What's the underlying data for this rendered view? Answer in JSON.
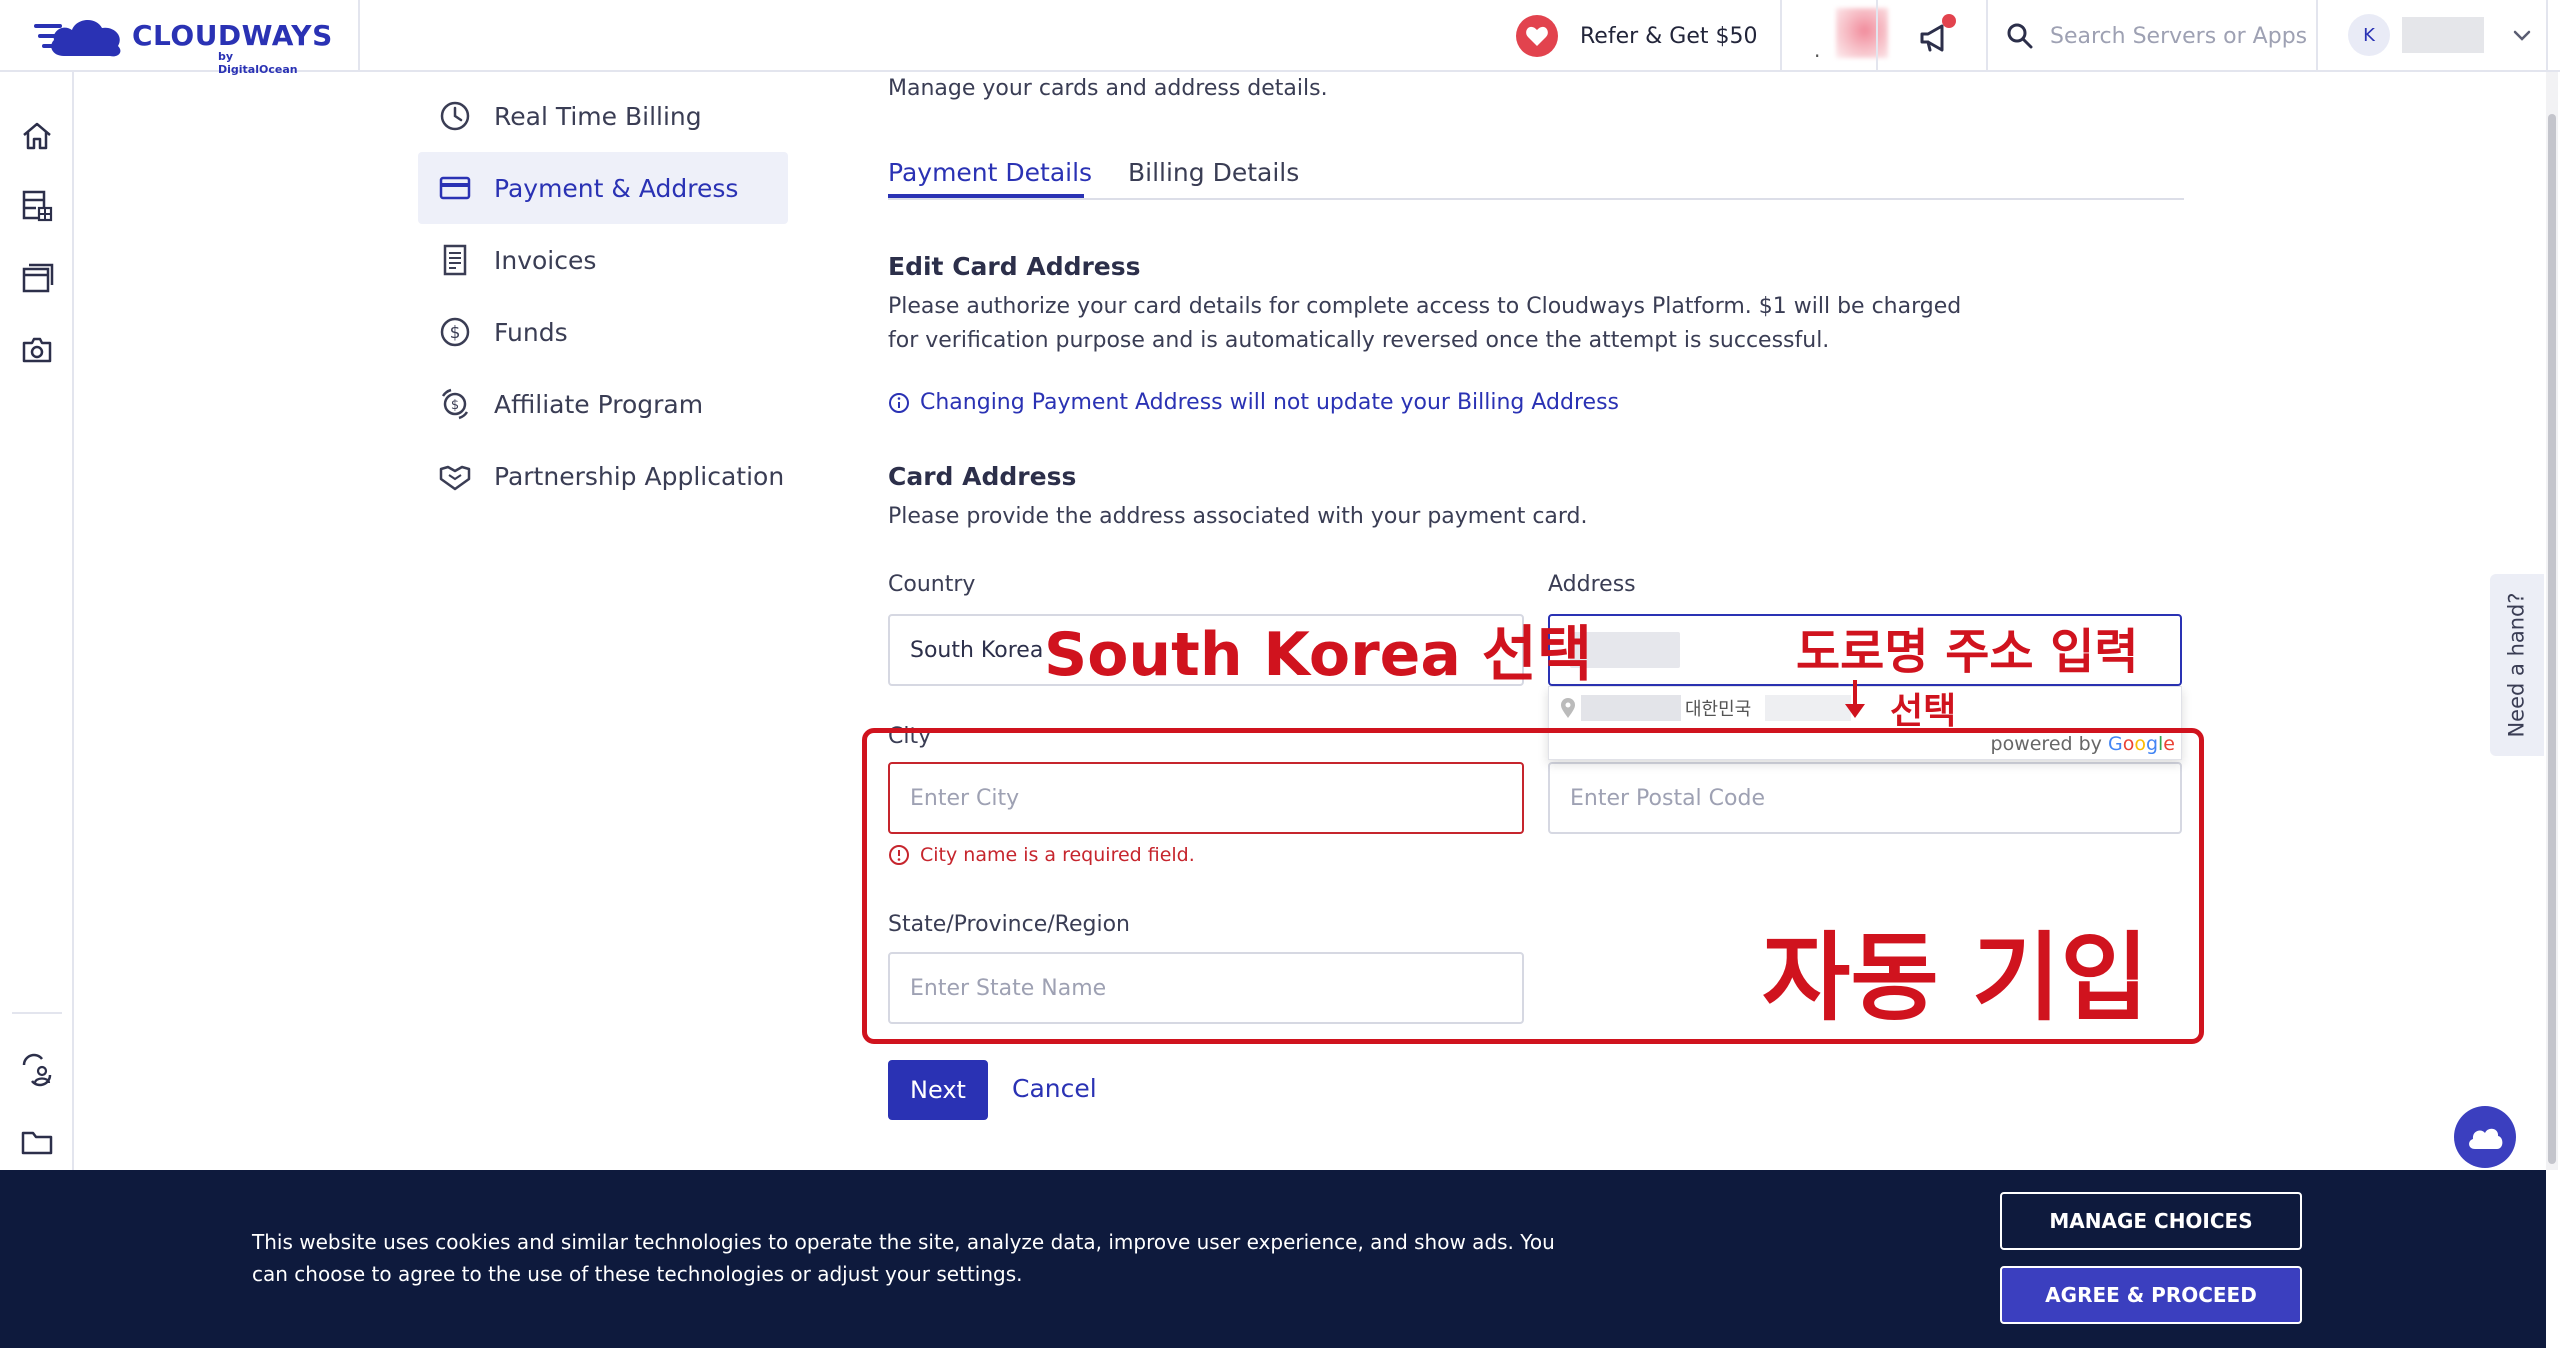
{
  "header": {
    "brand": "CLOUDWAYS",
    "brand_sub": "by DigitalOcean",
    "refer_label": "Refer & Get $50",
    "search_placeholder": "Search Servers or Apps",
    "user_initial": "K"
  },
  "settings_nav": [
    {
      "label": "Real Time Billing",
      "icon": "clock-icon"
    },
    {
      "label": "Payment & Address",
      "icon": "credit-card-icon",
      "active": true
    },
    {
      "label": "Invoices",
      "icon": "invoice-icon"
    },
    {
      "label": "Funds",
      "icon": "dollar-icon"
    },
    {
      "label": "Affiliate Program",
      "icon": "affiliate-icon"
    },
    {
      "label": "Partnership Application",
      "icon": "handshake-icon"
    }
  ],
  "main": {
    "subtitle": "Manage your cards and address details.",
    "tabs": [
      {
        "label": "Payment Details",
        "active": true
      },
      {
        "label": "Billing Details",
        "active": false
      }
    ],
    "edit_card_heading": "Edit Card Address",
    "edit_card_desc": "Please authorize your card details for complete access to Cloudways Platform. $1 will be charged for verification purpose and is automatically reversed once the attempt is successful.",
    "info_link": "Changing Payment Address will not update your Billing Address",
    "card_address_heading": "Card Address",
    "card_address_desc": "Please provide the address associated with your payment card.",
    "form": {
      "country_label": "Country",
      "country_value": "South Korea",
      "address_label": "Address",
      "city_label": "City",
      "city_placeholder": "Enter City",
      "city_error": "City name is a required field.",
      "postal_placeholder": "Enter Postal Code",
      "state_label": "State/Province/Region",
      "state_placeholder": "Enter State Name"
    },
    "autocomplete": {
      "suggestion_country": "대한민국",
      "powered_by": "powered by"
    },
    "next_label": "Next",
    "cancel_label": "Cancel"
  },
  "annotations": {
    "country_note": "South Korea 선택",
    "address_note": "도로명 주소 입력",
    "select_note": "선택",
    "autofill_note": "자동 기입"
  },
  "side": {
    "need_hand": "Need a hand?"
  },
  "cookie": {
    "text": "This website uses cookies and similar technologies to operate the site, analyze data, improve user experience, and show ads. You can choose to agree to the use of these technologies or adjust your settings.",
    "manage_label": "MANAGE CHOICES",
    "agree_label": "AGREE & PROCEED"
  },
  "colors": {
    "brand": "#2a32b4",
    "error": "#c6252d",
    "annotation": "#d0131e",
    "cookie_bg": "#0e1a3d"
  }
}
